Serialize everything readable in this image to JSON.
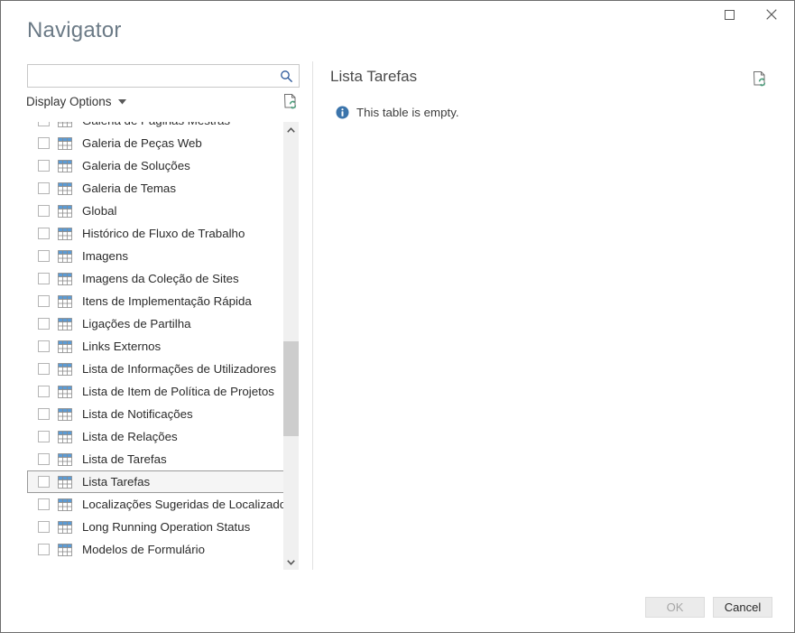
{
  "window": {
    "title": "Navigator",
    "controls": {
      "maximize": "maximize-icon",
      "close": "close-icon"
    }
  },
  "search": {
    "value": "",
    "placeholder": "",
    "icon": "search-icon"
  },
  "display_options": {
    "label": "Display Options",
    "caret": "chevron-down-icon"
  },
  "left_toolbar": {
    "refresh_icon": "refresh-document-icon"
  },
  "tree": {
    "selected": "Lista Tarefas",
    "items": [
      {
        "label": "Galeria de Páginas Mestras",
        "checked": false,
        "icon": "table-icon",
        "selected": false
      },
      {
        "label": "Galeria de Peças Web",
        "checked": false,
        "icon": "table-icon",
        "selected": false
      },
      {
        "label": "Galeria de Soluções",
        "checked": false,
        "icon": "table-icon",
        "selected": false
      },
      {
        "label": "Galeria de Temas",
        "checked": false,
        "icon": "table-icon",
        "selected": false
      },
      {
        "label": "Global",
        "checked": false,
        "icon": "table-icon",
        "selected": false
      },
      {
        "label": "Histórico de Fluxo de Trabalho",
        "checked": false,
        "icon": "table-icon",
        "selected": false
      },
      {
        "label": "Imagens",
        "checked": false,
        "icon": "table-icon",
        "selected": false
      },
      {
        "label": "Imagens da Coleção de Sites",
        "checked": false,
        "icon": "table-icon",
        "selected": false
      },
      {
        "label": "Itens de Implementação Rápida",
        "checked": false,
        "icon": "table-icon",
        "selected": false
      },
      {
        "label": "Ligações de Partilha",
        "checked": false,
        "icon": "table-icon",
        "selected": false
      },
      {
        "label": "Links Externos",
        "checked": false,
        "icon": "table-icon",
        "selected": false
      },
      {
        "label": "Lista de Informações de Utilizadores",
        "checked": false,
        "icon": "table-icon",
        "selected": false
      },
      {
        "label": "Lista de Item de Política de Projetos",
        "checked": false,
        "icon": "table-icon",
        "selected": false
      },
      {
        "label": "Lista de Notificações",
        "checked": false,
        "icon": "table-icon",
        "selected": false
      },
      {
        "label": "Lista de Relações",
        "checked": false,
        "icon": "table-icon",
        "selected": false
      },
      {
        "label": "Lista de Tarefas",
        "checked": false,
        "icon": "table-icon",
        "selected": false
      },
      {
        "label": "Lista Tarefas",
        "checked": false,
        "icon": "table-icon",
        "selected": true
      },
      {
        "label": "Localizações Sugeridas de Localizador...",
        "checked": false,
        "icon": "table-icon",
        "selected": false
      },
      {
        "label": "Long Running Operation Status",
        "checked": false,
        "icon": "table-icon",
        "selected": false
      },
      {
        "label": "Modelos de Formulário",
        "checked": false,
        "icon": "table-icon",
        "selected": false
      }
    ]
  },
  "scrollbar": {
    "up_arrow": "chevron-up-icon",
    "down_arrow": "chevron-down-icon"
  },
  "preview": {
    "title": "Lista Tarefas",
    "refresh_icon": "refresh-document-icon",
    "empty_icon": "info-icon",
    "empty_message": "This table is empty."
  },
  "footer": {
    "ok_label": "OK",
    "ok_enabled": false,
    "cancel_label": "Cancel",
    "cancel_enabled": true
  },
  "colors": {
    "accent_blue": "#2b579a",
    "info_blue": "#3b74ab",
    "table_icon_header": "#5b9bd5",
    "title_gray": "#6b7a86",
    "refresh_green": "#4a9c7a"
  }
}
